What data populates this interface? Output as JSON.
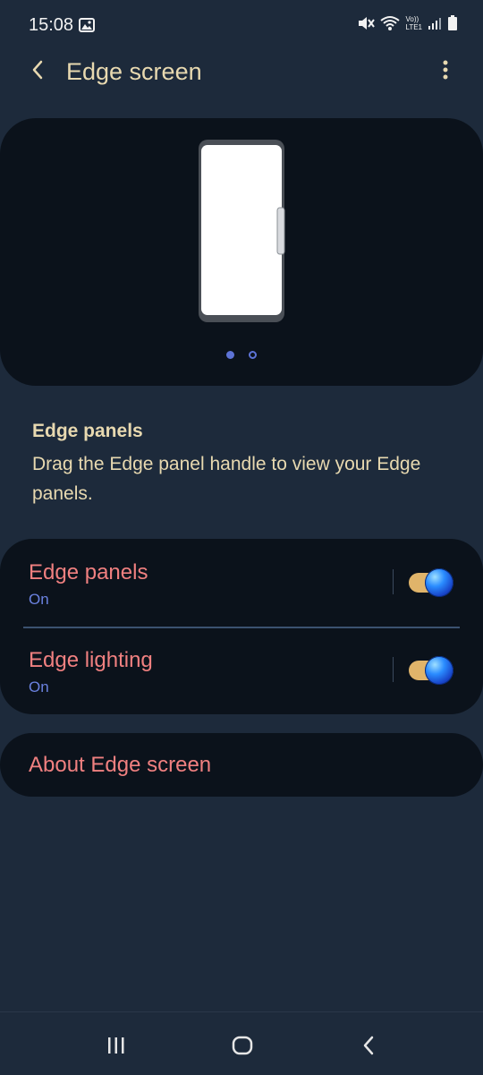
{
  "status_bar": {
    "time": "15:08",
    "icons": [
      "gallery-icon",
      "mute-icon",
      "wifi-icon",
      "volte-icon",
      "signal-icon",
      "battery-icon"
    ],
    "volte_label_top": "Vo))",
    "volte_label_bottom": "LTE1"
  },
  "app_bar": {
    "title": "Edge screen",
    "back_icon": "chevron-left-icon",
    "more_icon": "more-vert-icon"
  },
  "preview": {
    "pages": 2,
    "current_page": 1
  },
  "section": {
    "title": "Edge panels",
    "description": "Drag the Edge panel handle to view your Edge panels."
  },
  "settings": [
    {
      "label": "Edge panels",
      "status": "On",
      "enabled": true
    },
    {
      "label": "Edge lighting",
      "status": "On",
      "enabled": true
    }
  ],
  "about": {
    "label": "About Edge screen"
  },
  "nav_bar": {
    "recents_icon": "recents-icon",
    "home_icon": "home-icon",
    "back_icon": "back-icon"
  },
  "colors": {
    "background": "#1d2a3b",
    "card": "#0b121b",
    "title_text": "#e8d9b0",
    "setting_label": "#f08080",
    "setting_status": "#6b82e0",
    "toggle_track": "#e0b46a",
    "toggle_knob": "#2a8cff",
    "pager_dot": "#5d73d6"
  }
}
